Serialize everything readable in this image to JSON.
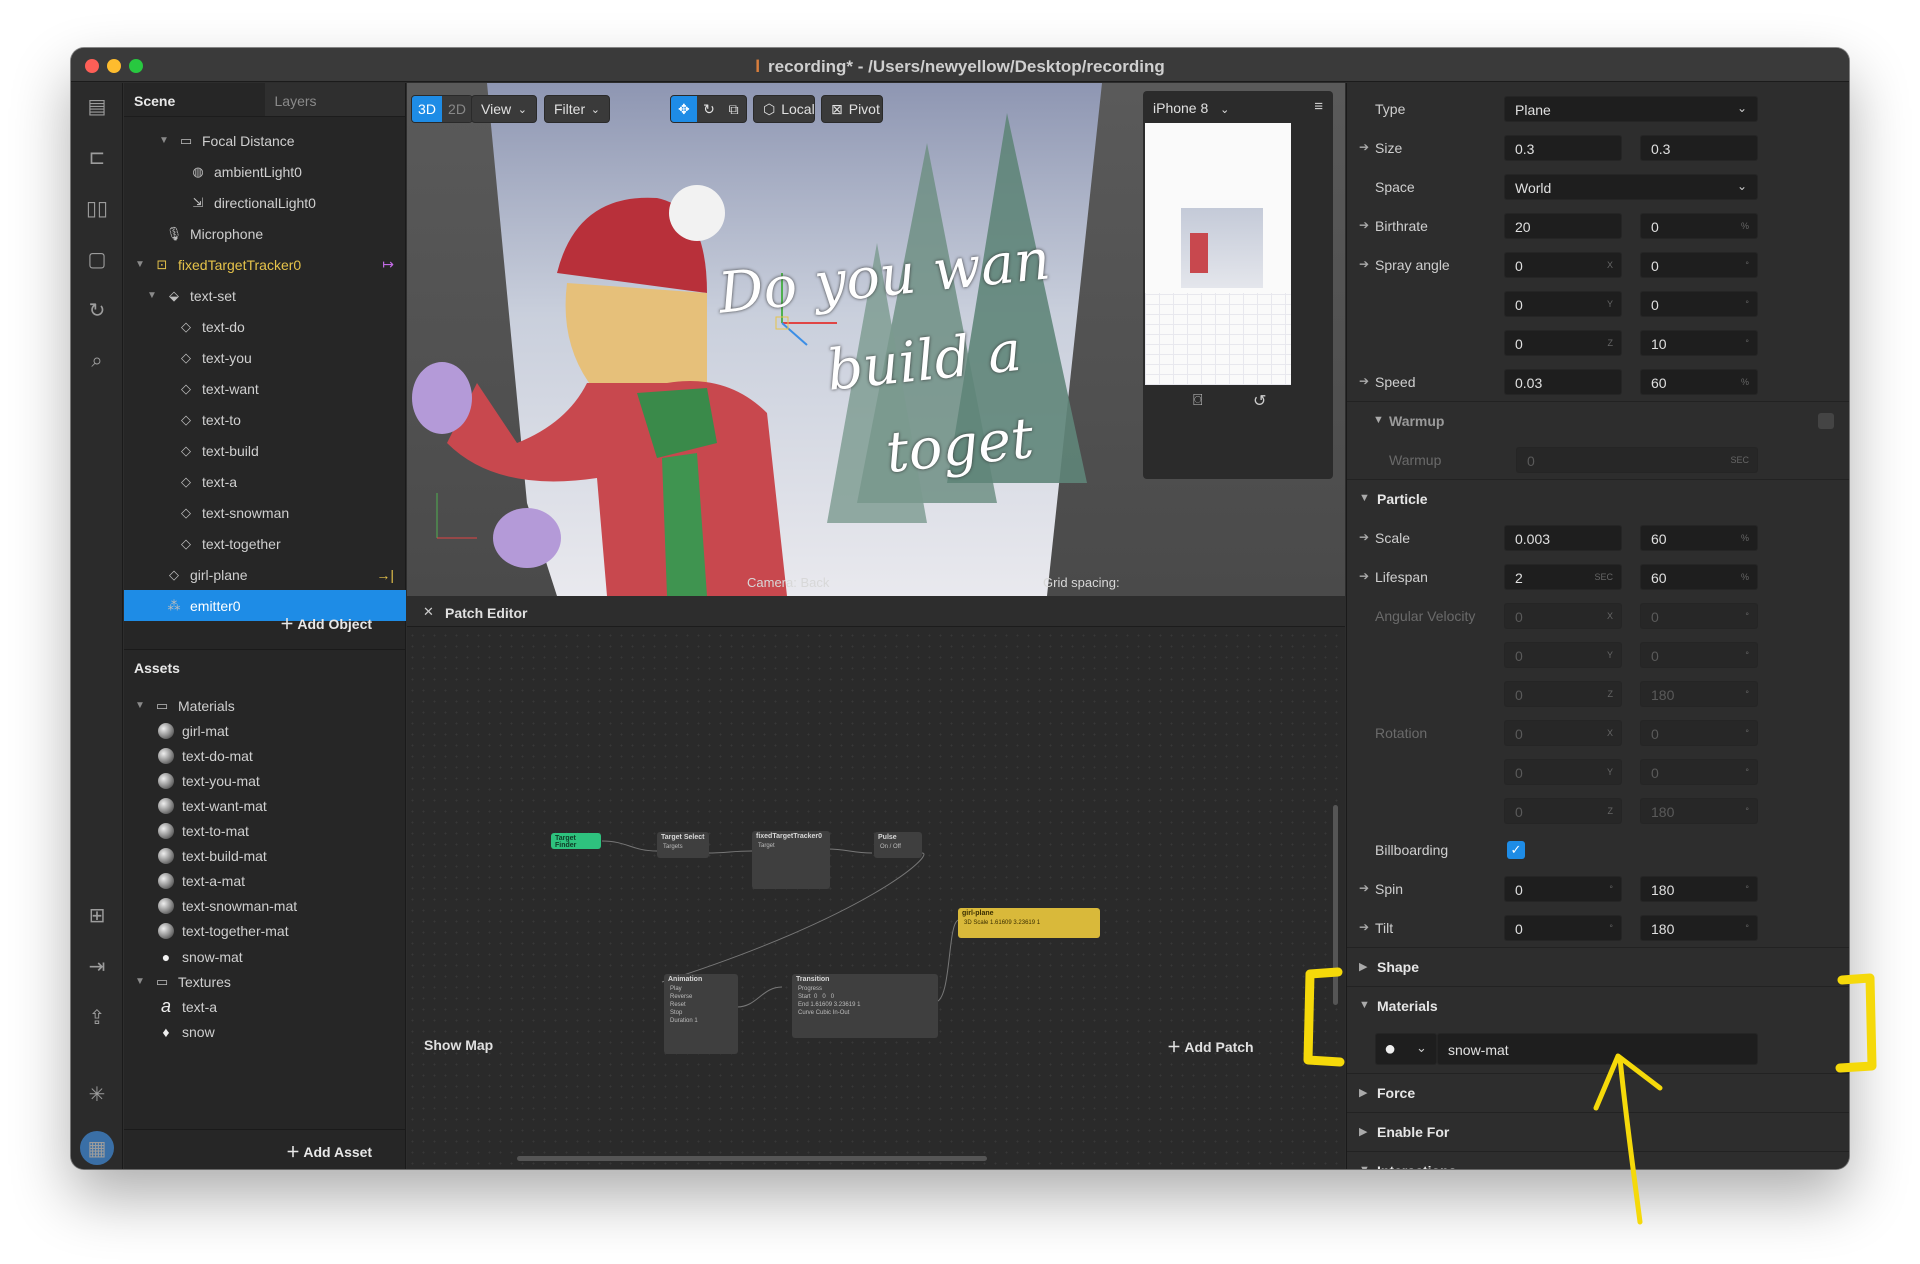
{
  "window": {
    "title": "recording* - /Users/newyellow/Desktop/recording"
  },
  "rail": {
    "icons": [
      "layout-icon",
      "video-camera-icon",
      "columns-icon",
      "square-icon",
      "sync-icon",
      "search-icon",
      "new-folder-icon",
      "device-icon",
      "share-icon",
      "bug-icon",
      "library-icon"
    ]
  },
  "scene": {
    "tabs": [
      "Scene",
      "Layers"
    ],
    "items": [
      {
        "label": "Focal Distance",
        "indent": 2,
        "arrow": "▼",
        "icon": "▭"
      },
      {
        "label": "ambientLight0",
        "indent": 3,
        "arrow": "",
        "icon": "◍"
      },
      {
        "label": "directionalLight0",
        "indent": 3,
        "arrow": "",
        "icon": "⇲"
      },
      {
        "label": "Microphone",
        "indent": 1,
        "arrow": "",
        "icon": "🎙"
      },
      {
        "label": "fixedTargetTracker0",
        "indent": 0,
        "arrow": "▼",
        "icon": "⊡",
        "yellow": true,
        "trail": "↦",
        "trailColor": "mag"
      },
      {
        "label": "text-set",
        "indent": 1,
        "arrow": "▼",
        "icon": "⬙"
      },
      {
        "label": "text-do",
        "indent": 2,
        "arrow": "",
        "icon": "◇"
      },
      {
        "label": "text-you",
        "indent": 2,
        "arrow": "",
        "icon": "◇"
      },
      {
        "label": "text-want",
        "indent": 2,
        "arrow": "",
        "icon": "◇"
      },
      {
        "label": "text-to",
        "indent": 2,
        "arrow": "",
        "icon": "◇"
      },
      {
        "label": "text-build",
        "indent": 2,
        "arrow": "",
        "icon": "◇"
      },
      {
        "label": "text-a",
        "indent": 2,
        "arrow": "",
        "icon": "◇"
      },
      {
        "label": "text-snowman",
        "indent": 2,
        "arrow": "",
        "icon": "◇"
      },
      {
        "label": "text-together",
        "indent": 2,
        "arrow": "",
        "icon": "◇"
      },
      {
        "label": "girl-plane",
        "indent": 1,
        "arrow": "",
        "icon": "◇",
        "trail": "→|",
        "trailColor": "yel"
      },
      {
        "label": "emitter0",
        "indent": 1,
        "arrow": "",
        "icon": "⁂",
        "selected": true
      }
    ],
    "add_object": "Add Object",
    "assets_title": "Assets",
    "assets": [
      {
        "label": "Materials",
        "type": "folder"
      },
      {
        "label": "girl-mat",
        "type": "mat"
      },
      {
        "label": "text-do-mat",
        "type": "mat"
      },
      {
        "label": "text-you-mat",
        "type": "mat"
      },
      {
        "label": "text-want-mat",
        "type": "mat"
      },
      {
        "label": "text-to-mat",
        "type": "mat"
      },
      {
        "label": "text-build-mat",
        "type": "mat"
      },
      {
        "label": "text-a-mat",
        "type": "mat"
      },
      {
        "label": "text-snowman-mat",
        "type": "mat"
      },
      {
        "label": "text-together-mat",
        "type": "mat"
      },
      {
        "label": "snow-mat",
        "type": "snow"
      },
      {
        "label": "Textures",
        "type": "folder"
      },
      {
        "label": "text-a",
        "type": "tex-a"
      },
      {
        "label": "snow",
        "type": "tex-snow"
      }
    ],
    "add_asset": "Add Asset"
  },
  "viewport": {
    "mode_3d": "3D",
    "mode_2d": "2D",
    "view": "View",
    "filter": "Filter",
    "local": "Local",
    "pivot": "Pivot",
    "device": "iPhone 8",
    "camera_label": "Camera: Back",
    "grid_label": "Grid spacing:",
    "overlay_lines": [
      "Do you wan",
      "build a",
      "toget"
    ]
  },
  "patch_editor": {
    "title": "Patch Editor",
    "show_map": "Show Map",
    "add_patch": "Add Patch",
    "nodes": {
      "target_finder": "Target Finder",
      "target_select": {
        "title": "Target Select",
        "ports": [
          "Targets"
        ]
      },
      "tracker": {
        "title": "fixedTargetTracker0",
        "ports": [
          "Target"
        ]
      },
      "pulse": {
        "title": "Pulse",
        "ports": [
          "On / Off"
        ]
      },
      "animation": {
        "title": "Animation",
        "ports": [
          "Play",
          "Reverse",
          "Reset",
          "Stop",
          "Duration"
        ],
        "duration": "1"
      },
      "transition": {
        "title": "Transition",
        "ports": [
          "Progress",
          "Start",
          "End",
          "Curve"
        ],
        "start": [
          "0",
          "0",
          "0"
        ],
        "end": [
          "1.61609",
          "3.23619",
          "1"
        ],
        "curve": "Cubic In-Out"
      },
      "girl_plane": {
        "title": "girl-plane",
        "port": "3D Scale",
        "values": [
          "1.61609",
          "3.23619",
          "1"
        ]
      }
    }
  },
  "inspector": {
    "type": {
      "label": "Type",
      "value": "Plane"
    },
    "size": {
      "label": "Size",
      "values": [
        "0.3",
        "0.3"
      ]
    },
    "space": {
      "label": "Space",
      "value": "World"
    },
    "birthrate": {
      "label": "Birthrate",
      "values": [
        "20",
        "0"
      ],
      "unit": "%"
    },
    "spray": {
      "label": "Spray angle",
      "rows": [
        [
          "0",
          "X",
          "0",
          "°"
        ],
        [
          "0",
          "Y",
          "0",
          "°"
        ],
        [
          "0",
          "Z",
          "10",
          "°"
        ]
      ]
    },
    "speed": {
      "label": "Speed",
      "values": [
        "0.03",
        "60"
      ],
      "unit": "%"
    },
    "warmup_header": "Warmup",
    "warmup": {
      "label": "Warmup",
      "value": "0",
      "unit": "SEC"
    },
    "particle_header": "Particle",
    "scale": {
      "label": "Scale",
      "values": [
        "0.003",
        "60"
      ],
      "unit": "%"
    },
    "lifespan": {
      "label": "Lifespan",
      "values": [
        "2",
        "60"
      ],
      "units": [
        "SEC",
        "%"
      ]
    },
    "angular": {
      "label": "Angular Velocity",
      "rows": [
        [
          "0",
          "X",
          "0",
          "°"
        ],
        [
          "0",
          "Y",
          "0",
          "°"
        ],
        [
          "0",
          "Z",
          "180",
          "°"
        ]
      ]
    },
    "rotation": {
      "label": "Rotation",
      "rows": [
        [
          "0",
          "X",
          "0",
          "°"
        ],
        [
          "0",
          "Y",
          "0",
          "°"
        ],
        [
          "0",
          "Z",
          "180",
          "°"
        ]
      ]
    },
    "billboarding": {
      "label": "Billboarding",
      "checked": true
    },
    "spin": {
      "label": "Spin",
      "values": [
        "0",
        "180"
      ],
      "unit": "°"
    },
    "tilt": {
      "label": "Tilt",
      "values": [
        "0",
        "180"
      ],
      "unit": "°"
    },
    "shape_header": "Shape",
    "materials_header": "Materials",
    "material_value": "snow-mat",
    "force_header": "Force",
    "enable_header": "Enable For",
    "interactions_header": "Interactions"
  },
  "colors": {
    "selection": "#1e8ce6",
    "tracker_yellow": "#e6c34a",
    "annotation": "#f5d90a",
    "patch_green": "#2ec27e"
  }
}
